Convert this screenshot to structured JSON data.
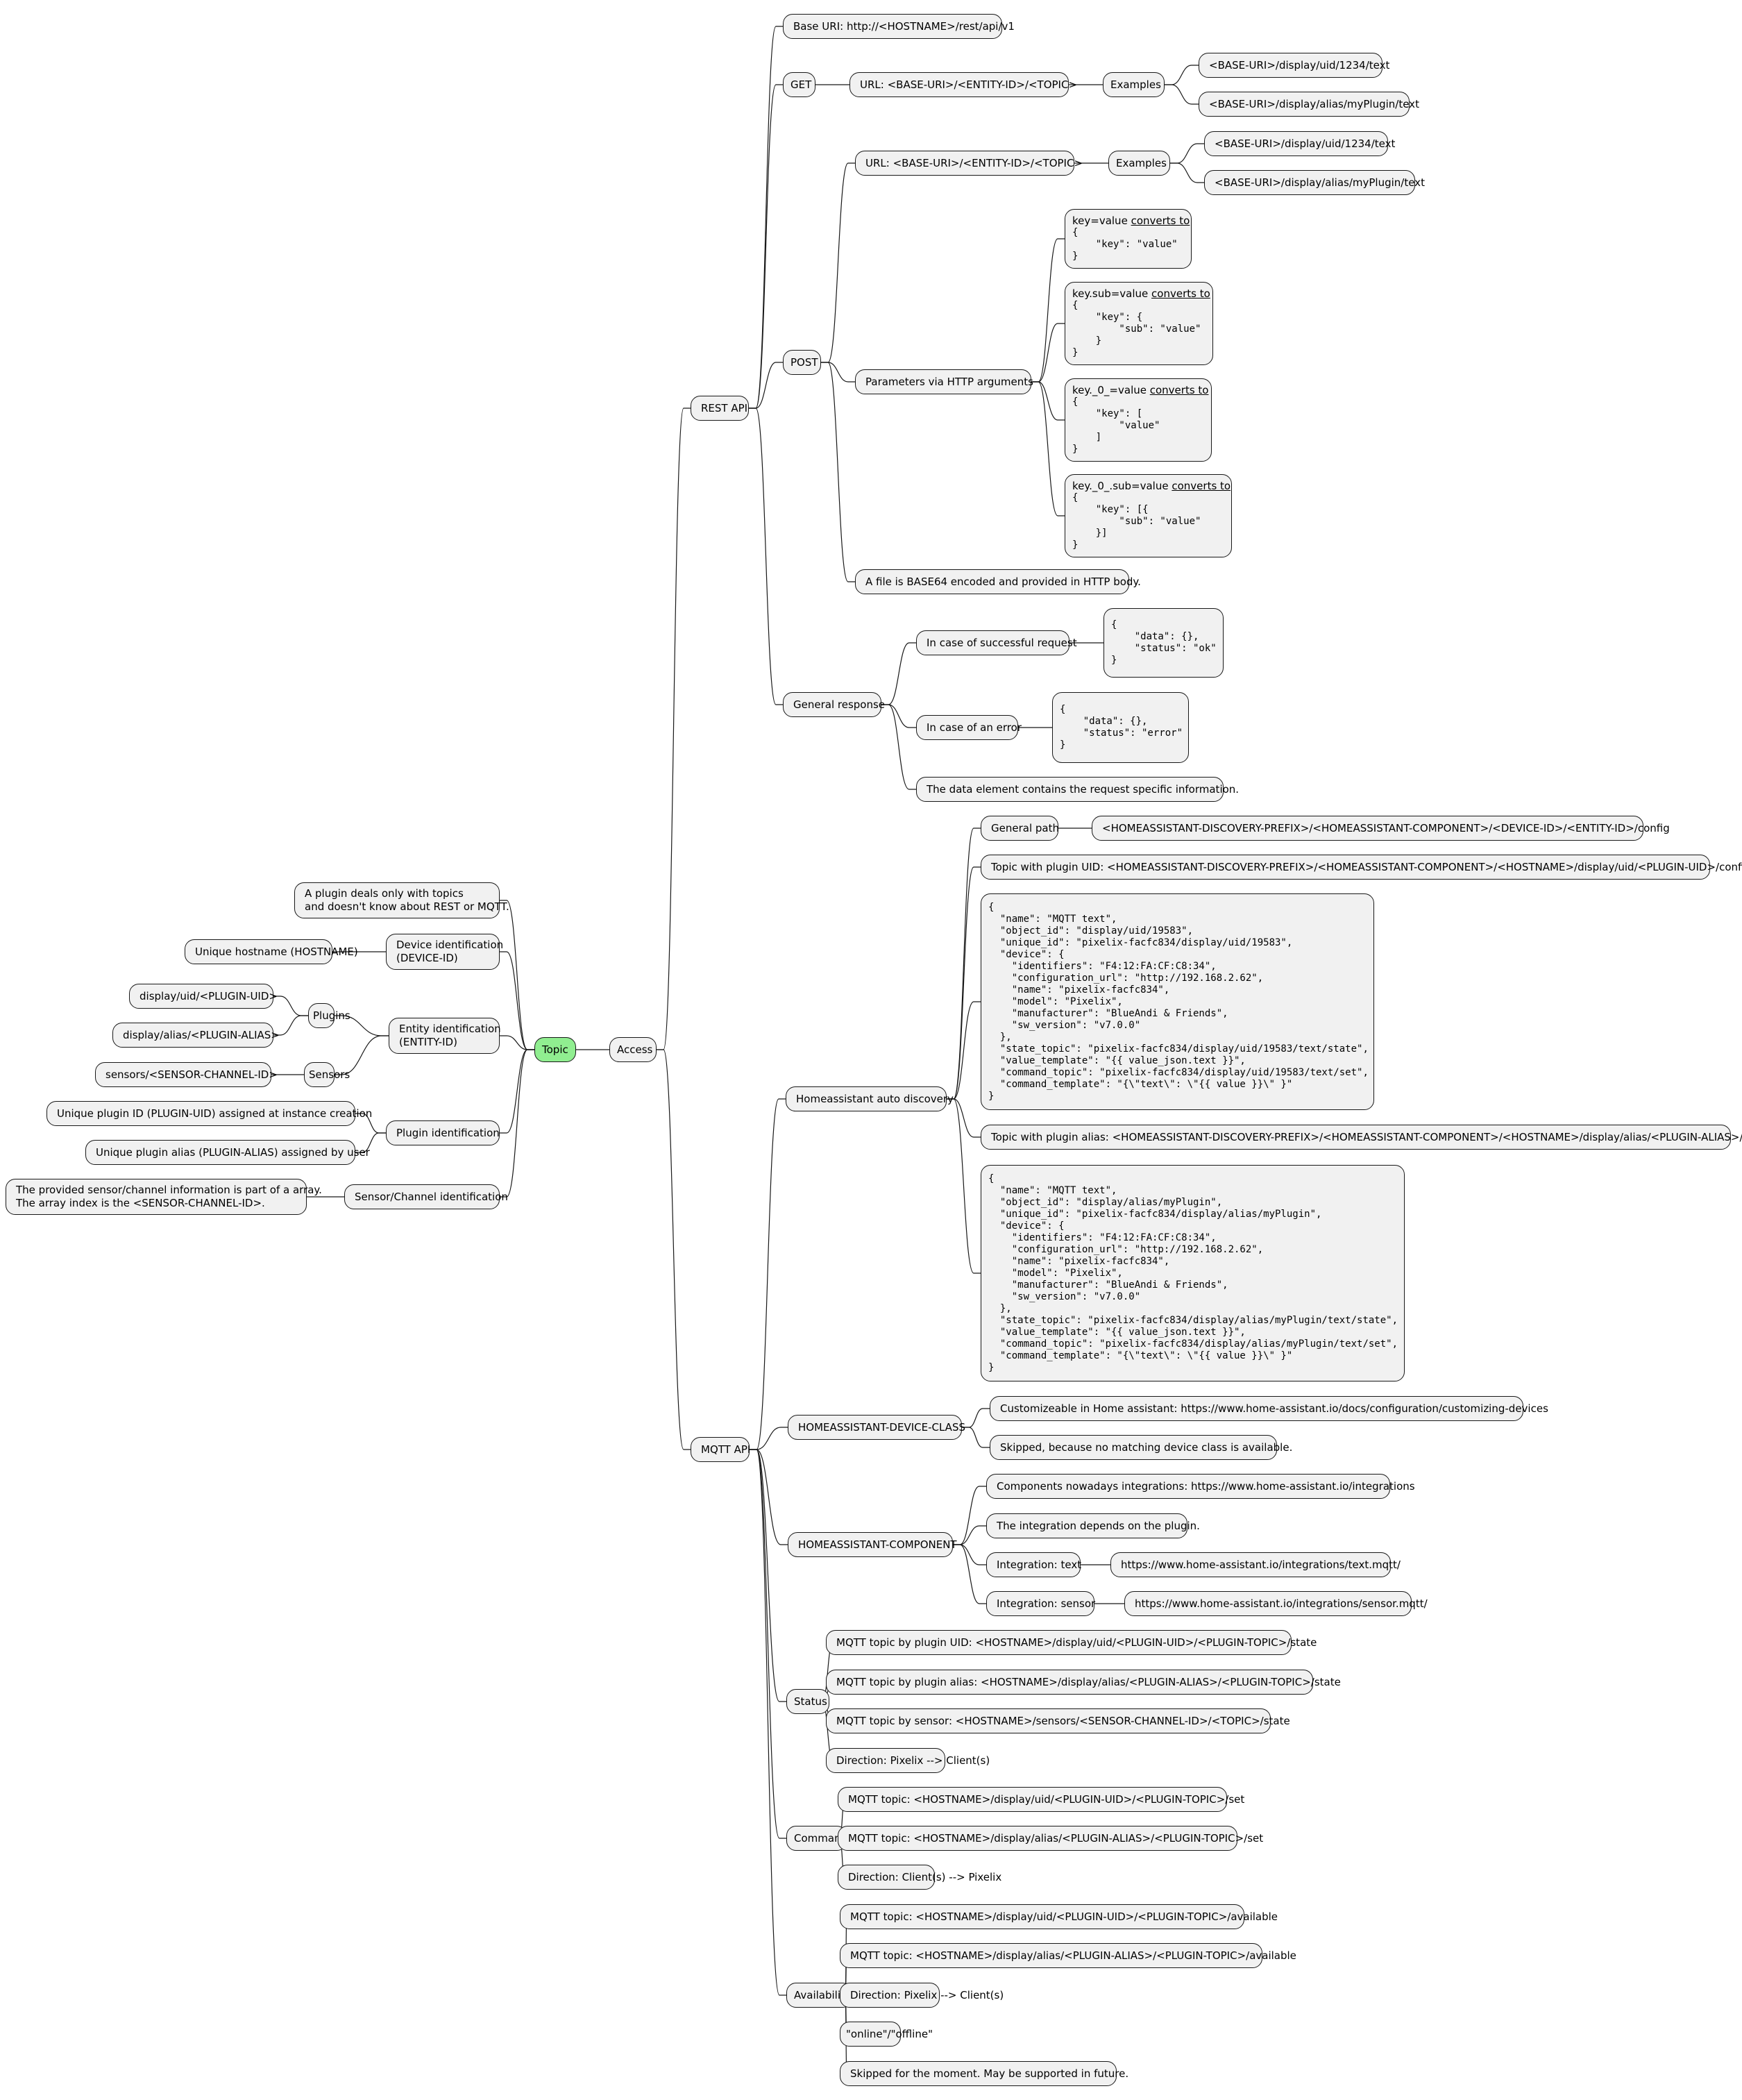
{
  "nodes": {
    "topic": "Topic",
    "access": "Access",
    "plugin_note": "A plugin deals only with topics\nand doesn't know about REST or MQTT.",
    "device_id": "Device identification\n(DEVICE-ID)",
    "unique_hostname": "Unique hostname (HOSTNAME)",
    "entity_id": "Entity identification\n(ENTITY-ID)",
    "plugins": "Plugins",
    "plugins_uid": "display/uid/<PLUGIN-UID>",
    "plugins_alias": "display/alias/<PLUGIN-ALIAS>",
    "sensors": "Sensors",
    "sensors_path": "sensors/<SENSOR-CHANNEL-ID>",
    "plugin_ident": "Plugin identification",
    "plugin_uid_desc": "Unique plugin ID (PLUGIN-UID) assigned at instance creation",
    "plugin_alias_desc": "Unique plugin alias (PLUGIN-ALIAS) assigned by user",
    "sensor_ident": "Sensor/Channel identification",
    "sensor_desc": "The provided sensor/channel information is part of a array.\nThe array index is the <SENSOR-CHANNEL-ID>.",
    "rest_api": "REST API",
    "base_uri": "Base URI: http://<HOSTNAME>/rest/api/v1",
    "get": "GET",
    "get_url": "URL: <BASE-URI>/<ENTITY-ID>/<TOPIC>",
    "get_examples": "Examples",
    "get_ex1": "<BASE-URI>/display/uid/1234/text",
    "get_ex2": "<BASE-URI>/display/alias/myPlugin/text",
    "post": "POST",
    "post_url": "URL: <BASE-URI>/<ENTITY-ID>/<TOPIC>",
    "post_examples": "Examples",
    "post_ex1": "<BASE-URI>/display/uid/1234/text",
    "post_ex2": "<BASE-URI>/display/alias/myPlugin/text",
    "post_params": "Parameters via HTTP arguments",
    "param1_key": "key=value ",
    "param1_conv": "converts to",
    "param1_code": "{\n    \"key\": \"value\"\n}",
    "param2_key": "key.sub=value ",
    "param2_conv": "converts to",
    "param2_code": "{\n    \"key\": {\n        \"sub\": \"value\"\n    }\n}",
    "param3_key": "key._0_=value ",
    "param3_conv": "converts to",
    "param3_code": "{\n    \"key\": [\n        \"value\"\n    ]\n}",
    "param4_key": "key._0_.sub=value ",
    "param4_conv": "converts to",
    "param4_code": "{\n    \"key\": [{\n        \"sub\": \"value\"\n    }]\n}",
    "post_file": "A file is BASE64 encoded and provided in HTTP body.",
    "general_response": "General response",
    "resp_success": "In case of successful request",
    "resp_success_code": "{\n    \"data\": {},\n    \"status\": \"ok\"\n}",
    "resp_error": "In case of an error",
    "resp_error_code": "{\n    \"data\": {},\n    \"status\": \"error\"\n}",
    "resp_data_note": "The data element contains the request specific information.",
    "mqtt_api": "MQTT API",
    "ha_discovery": "Homeassistant auto discovery",
    "general_path": "General path",
    "general_path_value": "<HOMEASSISTANT-DISCOVERY-PREFIX>/<HOMEASSISTANT-COMPONENT>/<DEVICE-ID>/<ENTITY-ID>/config",
    "topic_uid": "Topic with plugin UID: <HOMEASSISTANT-DISCOVERY-PREFIX>/<HOMEASSISTANT-COMPONENT>/<HOSTNAME>/display/uid/<PLUGIN-UID>/config",
    "uid_config_code": "{\n  \"name\": \"MQTT text\",\n  \"object_id\": \"display/uid/19583\",\n  \"unique_id\": \"pixelix-facfc834/display/uid/19583\",\n  \"device\": {\n    \"identifiers\": \"F4:12:FA:CF:C8:34\",\n    \"configuration_url\": \"http://192.168.2.62\",\n    \"name\": \"pixelix-facfc834\",\n    \"model\": \"Pixelix\",\n    \"manufacturer\": \"BlueAndi & Friends\",\n    \"sw_version\": \"v7.0.0\"\n  },\n  \"state_topic\": \"pixelix-facfc834/display/uid/19583/text/state\",\n  \"value_template\": \"{{ value_json.text }}\",\n  \"command_topic\": \"pixelix-facfc834/display/uid/19583/text/set\",\n  \"command_template\": \"{\\\"text\\\": \\\"{{ value }}\\\" }\"\n}",
    "topic_alias": "Topic with plugin alias: <HOMEASSISTANT-DISCOVERY-PREFIX>/<HOMEASSISTANT-COMPONENT>/<HOSTNAME>/display/alias/<PLUGIN-ALIAS>/config",
    "alias_config_code": "{\n  \"name\": \"MQTT text\",\n  \"object_id\": \"display/alias/myPlugin\",\n  \"unique_id\": \"pixelix-facfc834/display/alias/myPlugin\",\n  \"device\": {\n    \"identifiers\": \"F4:12:FA:CF:C8:34\",\n    \"configuration_url\": \"http://192.168.2.62\",\n    \"name\": \"pixelix-facfc834\",\n    \"model\": \"Pixelix\",\n    \"manufacturer\": \"BlueAndi & Friends\",\n    \"sw_version\": \"v7.0.0\"\n  },\n  \"state_topic\": \"pixelix-facfc834/display/alias/myPlugin/text/state\",\n  \"value_template\": \"{{ value_json.text }}\",\n  \"command_topic\": \"pixelix-facfc834/display/alias/myPlugin/text/set\",\n  \"command_template\": \"{\\\"text\\\": \\\"{{ value }}\\\" }\"\n}",
    "ha_device_class": "HOMEASSISTANT-DEVICE-CLASS",
    "device_class_custom": "Customizeable in Home assistant: https://www.home-assistant.io/docs/configuration/customizing-devices",
    "device_class_skipped": "Skipped, because no matching device class is available.",
    "ha_component": "HOMEASSISTANT-COMPONENT",
    "component_integrations": "Components nowadays integrations: https://www.home-assistant.io/integrations",
    "component_depends": "The integration depends on the plugin.",
    "integration_text": "Integration: text",
    "integration_text_url": "https://www.home-assistant.io/integrations/text.mqtt/",
    "integration_sensor": "Integration: sensor",
    "integration_sensor_url": "https://www.home-assistant.io/integrations/sensor.mqtt/",
    "status": "Status",
    "status_uid": "MQTT topic by plugin UID: <HOSTNAME>/display/uid/<PLUGIN-UID>/<PLUGIN-TOPIC>/state",
    "status_alias": "MQTT topic by plugin alias: <HOSTNAME>/display/alias/<PLUGIN-ALIAS>/<PLUGIN-TOPIC>/state",
    "status_sensor": "MQTT topic by sensor: <HOSTNAME>/sensors/<SENSOR-CHANNEL-ID>/<TOPIC>/state",
    "status_direction": "Direction: Pixelix --> Client(s)",
    "command": "Command",
    "command_uid": "MQTT topic: <HOSTNAME>/display/uid/<PLUGIN-UID>/<PLUGIN-TOPIC>/set",
    "command_alias": "MQTT topic: <HOSTNAME>/display/alias/<PLUGIN-ALIAS>/<PLUGIN-TOPIC>/set",
    "command_direction": "Direction: Client(s) --> Pixelix",
    "availability": "Availability",
    "avail_uid": "MQTT topic: <HOSTNAME>/display/uid/<PLUGIN-UID>/<PLUGIN-TOPIC>/available",
    "avail_alias": "MQTT topic: <HOSTNAME>/display/alias/<PLUGIN-ALIAS>/<PLUGIN-TOPIC>/available",
    "avail_direction": "Direction: Pixelix --> Client(s)",
    "avail_values": "\"online\"/\"offline\"",
    "avail_skipped": "Skipped for the moment. May be supported in future."
  },
  "colors": {
    "root_fill": "#90ee90",
    "node_fill": "#f1f1f1",
    "border": "#181818"
  }
}
